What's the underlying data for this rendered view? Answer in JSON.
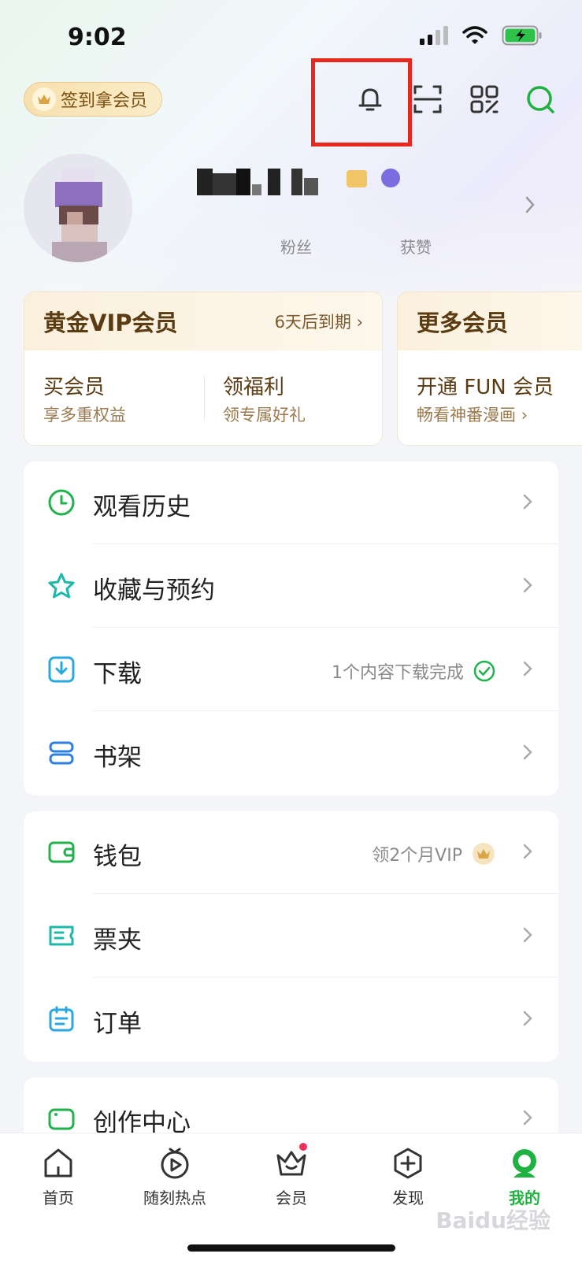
{
  "status_bar": {
    "time": "9:02"
  },
  "header": {
    "signin_label": "签到拿会员",
    "icons": [
      "bell-icon",
      "scan-icon",
      "qr-code-icon",
      "search-icon"
    ]
  },
  "profile": {
    "fans_label": "粉丝",
    "likes_label": "获赞"
  },
  "vip_card": {
    "title": "黄金VIP会员",
    "expiry": "6天后到期 ›",
    "benefits": [
      {
        "title": "买会员",
        "subtitle": "享多重权益"
      },
      {
        "title": "领福利",
        "subtitle": "领专属好礼"
      }
    ]
  },
  "more_card": {
    "title": "更多会员",
    "benefit_title": "开通 FUN 会员",
    "benefit_subtitle": "畅看神番漫画 ›"
  },
  "menu_group_1": [
    {
      "label": "观看历史",
      "icon": "clock-icon"
    },
    {
      "label": "收藏与预约",
      "icon": "star-icon"
    },
    {
      "label": "下载",
      "icon": "download-icon",
      "extra": "1个内容下载完成"
    },
    {
      "label": "书架",
      "icon": "bookshelf-icon"
    }
  ],
  "menu_group_2": [
    {
      "label": "钱包",
      "icon": "wallet-icon",
      "extra": "领2个月VIP"
    },
    {
      "label": "票夹",
      "icon": "ticket-icon"
    },
    {
      "label": "订单",
      "icon": "order-icon"
    }
  ],
  "menu_group_3": [
    {
      "label": "创作中心",
      "icon": "video-camera-icon"
    }
  ],
  "bottom_nav": [
    {
      "label": "首页",
      "icon": "home-icon"
    },
    {
      "label": "随刻热点",
      "icon": "play-circle-icon"
    },
    {
      "label": "会员",
      "icon": "crown-icon",
      "badge": true
    },
    {
      "label": "发现",
      "icon": "discover-plus-icon"
    },
    {
      "label": "我的",
      "icon": "profile-icon",
      "active": true
    }
  ],
  "watermark": "Baidu经验",
  "colors": {
    "accent": "#1fb141",
    "highlight": "#e8281f",
    "gold": "#5a3b12"
  }
}
